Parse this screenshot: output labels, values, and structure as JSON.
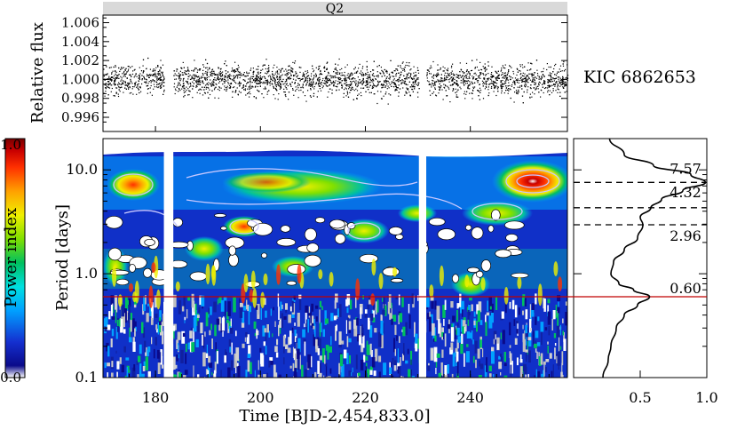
{
  "chart_data": [
    {
      "type": "scatter",
      "panel": "light-curve",
      "quarter_label": "Q2",
      "star_label": "KIC 6862653",
      "ylabel": "Relative flux",
      "xlim": [
        170,
        258.5
      ],
      "ylim": [
        0.9945,
        1.0068
      ],
      "yticks": [
        0.996,
        0.998,
        1.0,
        1.002,
        1.004,
        1.006
      ],
      "ytick_labels": [
        "0.996",
        "0.998",
        "1.000",
        "1.002",
        "1.004",
        "1.006"
      ],
      "gaps": [
        [
          181.6,
          183.4
        ],
        [
          230.2,
          231.6
        ]
      ],
      "flux_center": 1.0,
      "flux_scatter": 0.0015,
      "background_band_color": "#d9d9d9"
    },
    {
      "type": "heatmap",
      "panel": "wavelet-power",
      "xlabel": "Time [BJD-2,454,833.0]",
      "ylabel": "Period [days]",
      "xlim": [
        170,
        258.5
      ],
      "xticks": [
        180,
        200,
        220,
        240
      ],
      "xtick_labels": [
        "180",
        "200",
        "220",
        "240"
      ],
      "ylim": [
        0.1,
        20
      ],
      "yscale": "log",
      "yticks": [
        0.1,
        1.0,
        10.0
      ],
      "ytick_labels": [
        "0.1",
        "1.0",
        "10.0"
      ],
      "colorbar": {
        "label": "Power index",
        "range": [
          0.0,
          1.0
        ],
        "tick_labels": [
          "0.0",
          "1.0"
        ],
        "colors": [
          "#ffffff",
          "#0a0a8a",
          "#1430d0",
          "#00a0ff",
          "#00e0e0",
          "#00c060",
          "#80e000",
          "#f0f000",
          "#ffa000",
          "#ff3000",
          "#c80000",
          "#780000"
        ]
      },
      "features": [
        {
          "time": 175,
          "period": 7.0,
          "power": 0.85
        },
        {
          "time": 196,
          "period": 3.1,
          "power": 0.9
        },
        {
          "time": 210,
          "period": 7.5,
          "power": 0.75
        },
        {
          "time": 248,
          "period": 7.5,
          "power": 1.0
        },
        {
          "time": 225,
          "period": 3.0,
          "power": 0.6
        },
        {
          "time": 185,
          "period": 0.8,
          "power": 0.6
        }
      ]
    },
    {
      "type": "line",
      "panel": "global-wavelet-spectrum",
      "xlim": [
        0.0,
        1.0
      ],
      "xticks": [
        0.5,
        1.0
      ],
      "xtick_labels": [
        "0.5",
        "1.0"
      ],
      "ylim": [
        0.1,
        20
      ],
      "yscale": "log",
      "points": [
        {
          "period": 0.1,
          "power": 0.22
        },
        {
          "period": 0.15,
          "power": 0.26
        },
        {
          "period": 0.2,
          "power": 0.28
        },
        {
          "period": 0.3,
          "power": 0.32
        },
        {
          "period": 0.4,
          "power": 0.38
        },
        {
          "period": 0.5,
          "power": 0.48
        },
        {
          "period": 0.6,
          "power": 0.57
        },
        {
          "period": 0.7,
          "power": 0.45
        },
        {
          "period": 0.8,
          "power": 0.34
        },
        {
          "period": 1.0,
          "power": 0.28
        },
        {
          "period": 1.3,
          "power": 0.3
        },
        {
          "period": 1.7,
          "power": 0.38
        },
        {
          "period": 2.2,
          "power": 0.48
        },
        {
          "period": 2.96,
          "power": 0.52
        },
        {
          "period": 3.5,
          "power": 0.5
        },
        {
          "period": 4.32,
          "power": 0.58
        },
        {
          "period": 5.2,
          "power": 0.66
        },
        {
          "period": 6.3,
          "power": 0.82
        },
        {
          "period": 7.57,
          "power": 0.99
        },
        {
          "period": 9.0,
          "power": 0.88
        },
        {
          "period": 11.0,
          "power": 0.6
        },
        {
          "period": 14.0,
          "power": 0.38
        },
        {
          "period": 20.0,
          "power": 0.27
        }
      ],
      "peaks": [
        {
          "period": 7.57,
          "label": "7.57",
          "style": "dashed",
          "color": "#000000"
        },
        {
          "period": 4.32,
          "label": "4.32",
          "style": "dashed",
          "color": "#000000"
        },
        {
          "period": 2.96,
          "label": "2.96",
          "style": "dashed",
          "color": "#000000"
        },
        {
          "period": 0.6,
          "label": "0.60",
          "style": "solid",
          "color": "#c00000"
        }
      ]
    }
  ]
}
